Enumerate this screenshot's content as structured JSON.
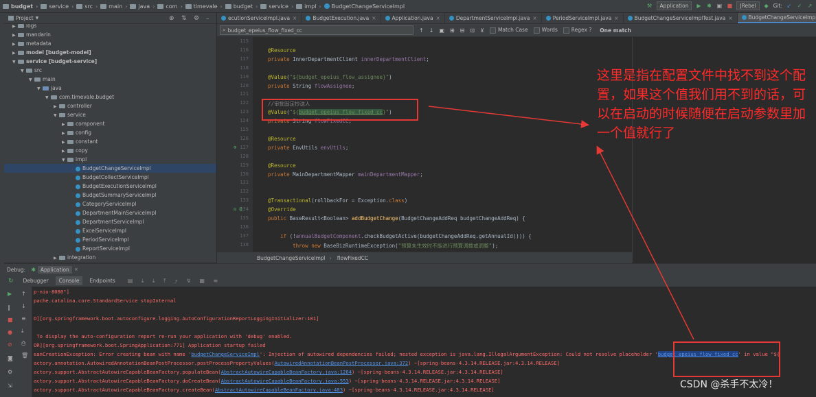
{
  "breadcrumbs": [
    "budget",
    "service",
    "src",
    "main",
    "java",
    "com",
    "timevale",
    "budget",
    "service",
    "impl",
    "BudgetChangeServiceImpl"
  ],
  "toolbar": {
    "run_config": "Application",
    "jrebel": "JRebel",
    "git_label": "Git:"
  },
  "project_panel": {
    "title": "Project",
    "tree": [
      {
        "label": "logs",
        "depth": 1,
        "kind": "folder",
        "arrow": "▶"
      },
      {
        "label": "mandarin",
        "depth": 1,
        "kind": "folder",
        "arrow": "▶"
      },
      {
        "label": "metadata",
        "depth": 1,
        "kind": "folder",
        "arrow": "▶"
      },
      {
        "label": "model [budget-model]",
        "depth": 1,
        "kind": "folder",
        "arrow": "▶",
        "bold": true
      },
      {
        "label": "service [budget-service]",
        "depth": 1,
        "kind": "folder",
        "arrow": "▼",
        "bold": true
      },
      {
        "label": "src",
        "depth": 2,
        "kind": "folder",
        "arrow": "▼"
      },
      {
        "label": "main",
        "depth": 3,
        "kind": "folder",
        "arrow": "▼"
      },
      {
        "label": "java",
        "depth": 4,
        "kind": "folder-blue",
        "arrow": "▼"
      },
      {
        "label": "com.timevale.budget",
        "depth": 5,
        "kind": "folder",
        "arrow": "▼"
      },
      {
        "label": "controller",
        "depth": 6,
        "kind": "folder",
        "arrow": "▶"
      },
      {
        "label": "service",
        "depth": 6,
        "kind": "folder",
        "arrow": "▼"
      },
      {
        "label": "component",
        "depth": 7,
        "kind": "folder",
        "arrow": "▶"
      },
      {
        "label": "config",
        "depth": 7,
        "kind": "folder",
        "arrow": "▶"
      },
      {
        "label": "constant",
        "depth": 7,
        "kind": "folder",
        "arrow": "▶"
      },
      {
        "label": "copy",
        "depth": 7,
        "kind": "folder",
        "arrow": "▶"
      },
      {
        "label": "impl",
        "depth": 7,
        "kind": "folder",
        "arrow": "▼"
      },
      {
        "label": "BudgetChangeServiceImpl",
        "depth": 8,
        "kind": "class",
        "selected": true
      },
      {
        "label": "BudgetCollectServiceImpl",
        "depth": 8,
        "kind": "class"
      },
      {
        "label": "BudgetExecutionServiceImpl",
        "depth": 8,
        "kind": "class"
      },
      {
        "label": "BudgetSummaryServiceImpl",
        "depth": 8,
        "kind": "class"
      },
      {
        "label": "CategoryServiceImpl",
        "depth": 8,
        "kind": "class"
      },
      {
        "label": "DepartmentMainServiceImpl",
        "depth": 8,
        "kind": "class"
      },
      {
        "label": "DepartmentServiceImpl",
        "depth": 8,
        "kind": "class"
      },
      {
        "label": "ExcelServiceImpl",
        "depth": 8,
        "kind": "class"
      },
      {
        "label": "PeriodServiceImpl",
        "depth": 8,
        "kind": "class"
      },
      {
        "label": "ReportServiceImpl",
        "depth": 8,
        "kind": "class"
      },
      {
        "label": "integration",
        "depth": 6,
        "kind": "folder",
        "arrow": "▶"
      }
    ]
  },
  "editor_tabs": [
    {
      "label": "ecutionServiceImpl.java",
      "active": false
    },
    {
      "label": "BudgetExecution.java",
      "active": false
    },
    {
      "label": "Application.java",
      "active": false
    },
    {
      "label": "DepartmentServiceImpl.java",
      "active": false
    },
    {
      "label": "PeriodServiceImpl.java",
      "active": false
    },
    {
      "label": "BudgetChangeServiceImplTest.java",
      "active": false
    },
    {
      "label": "BudgetChangeServiceImpl.java",
      "active": true
    }
  ],
  "search": {
    "query": "budget_epeius_flow_fixed_cc",
    "match_case": "Match Case",
    "words": "Words",
    "regex": "Regex",
    "result": "One match"
  },
  "code_lines": [
    {
      "n": "115",
      "html": ""
    },
    {
      "n": "116",
      "html": "<span class='ann'>@Resource</span>"
    },
    {
      "n": "117",
      "html": "<span class='kw'>private</span> InnerDepartmentClient <span class='fld'>innerDepartmentClient</span>;"
    },
    {
      "n": "118",
      "html": ""
    },
    {
      "n": "119",
      "html": "<span class='ann'>@Value</span>(<span class='str'>\"${budget_epeius_flow_assignee}\"</span>)"
    },
    {
      "n": "120",
      "html": "<span class='kw'>private</span> String <span class='fld'>flowAssignee</span>;"
    },
    {
      "n": "121",
      "html": ""
    },
    {
      "n": "122",
      "html": "<span class='cmt'>//审批固定抄送人</span>"
    },
    {
      "n": "123",
      "html": "<span class='ann'>@Value</span>(<span class='str'>\"${<span class='hl'>budget_epeius_flow_fixed_cc</span>}\"</span>)"
    },
    {
      "n": "124",
      "html": "<span class='kw'>private</span> String <span class='fld'>flowFixedCC</span>;"
    },
    {
      "n": "125",
      "html": ""
    },
    {
      "n": "126",
      "html": "<span class='ann'>@Resource</span>"
    },
    {
      "n": "127",
      "html": "<span class='kw'>private</span> EnvUtils <span class='fld'>envUtils</span>;"
    },
    {
      "n": "128",
      "html": ""
    },
    {
      "n": "129",
      "html": "<span class='ann'>@Resource</span>"
    },
    {
      "n": "130",
      "html": "<span class='kw'>private</span> MainDepartmentMapper <span class='fld'>mainDepartmentMapper</span>;"
    },
    {
      "n": "131",
      "html": ""
    },
    {
      "n": "132",
      "html": ""
    },
    {
      "n": "133",
      "html": "<span class='ann'>@Transactional</span>(rollbackFor = Exception.<span class='kw'>class</span>)"
    },
    {
      "n": "134",
      "html": "<span class='ann'>@Override</span>"
    },
    {
      "n": "135",
      "html": "<span class='kw'>public</span> BaseResult&lt;Boolean&gt; <span class='mth'>addBudgetChange</span>(BudgetChangeAddReq budgetChangeAddReq) {"
    },
    {
      "n": "136",
      "html": ""
    },
    {
      "n": "137",
      "html": "    <span class='kw'>if</span> (!<span class='fld'>annualBudgetComponent</span>.checkBudgetActive(budgetChangeAddReq.getAnnualId())) {"
    },
    {
      "n": "138",
      "html": "        <span class='kw'>throw new</span> BaseBizRuntimeException(<span class='str'>\"预算未生效时不能进行预算调拨或调整\"</span>);"
    }
  ],
  "editor_breadcrumb": [
    "BudgetChangeServiceImpl",
    "flowFixedCC"
  ],
  "debug": {
    "label": "Debug:",
    "config": "Application",
    "tabs": [
      "Debugger",
      "Console",
      "Endpoints"
    ]
  },
  "console_lines": [
    {
      "html": "p-nio-8080\"]"
    },
    {
      "html": "pache.catalina.core.StandardService stopInternal"
    },
    {
      "html": ""
    },
    {
      "html": "O][org.springframework.boot.autoconfigure.logging.AutoConfigurationReportLoggingInitializer:101]"
    },
    {
      "html": ""
    },
    {
      "html": " To display the auto-configuration report re-run your application with 'debug' enabled."
    },
    {
      "html": "OR][org.springframework.boot.SpringApplication:771] Application startup failed"
    },
    {
      "html": "eanCreationException: Error creating bean with name '<span class='clink'>budgetChangeServiceImpl</span>': Injection of autowired dependencies failed; nested exception is java.lang.IllegalArgumentException: Could not resolve placeholder '<span class='chl'>budget_epeius_flow_fixed_cc</span>' in value \"${"
    },
    {
      "html": "actory.annotation.AutowiredAnnotationBeanPostProcessor.postProcessPropertyValues(<span class='clink'>AutowiredAnnotationBeanPostProcessor.java:372</span>) ~[spring-beans-4.3.14.RELEASE.jar:4.3.14.RELEASE]"
    },
    {
      "html": "actory.support.AbstractAutowireCapableBeanFactory.populateBean(<span class='clink'>AbstractAutowireCapableBeanFactory.java:1264</span>) ~[spring-beans-4.3.14.RELEASE.jar:4.3.14.RELEASE]"
    },
    {
      "html": "actory.support.AbstractAutowireCapableBeanFactory.doCreateBean(<span class='clink'>AbstractAutowireCapableBeanFactory.java:553</span>) ~[spring-beans-4.3.14.RELEASE.jar:4.3.14.RELEASE]"
    },
    {
      "html": "actory.support.AbstractAutowireCapableBeanFactory.createBean(<span class='clink'>AbstractAutowireCapableBeanFactory.java:483</span>) ~[spring-beans-4.3.14.RELEASE.jar:4.3.14.RELEASE]"
    }
  ],
  "annotation_note": "这里是指在配置文件中找不到这个配置，如果这个值我们用不到的话，可以在启动的时候随便在启动参数里加一个值就行了",
  "watermark": "CSDN @杀手不太冷！",
  "colors": {
    "annotation": "#e53935",
    "selection": "#2f4565",
    "accent": "#4a88c7"
  }
}
